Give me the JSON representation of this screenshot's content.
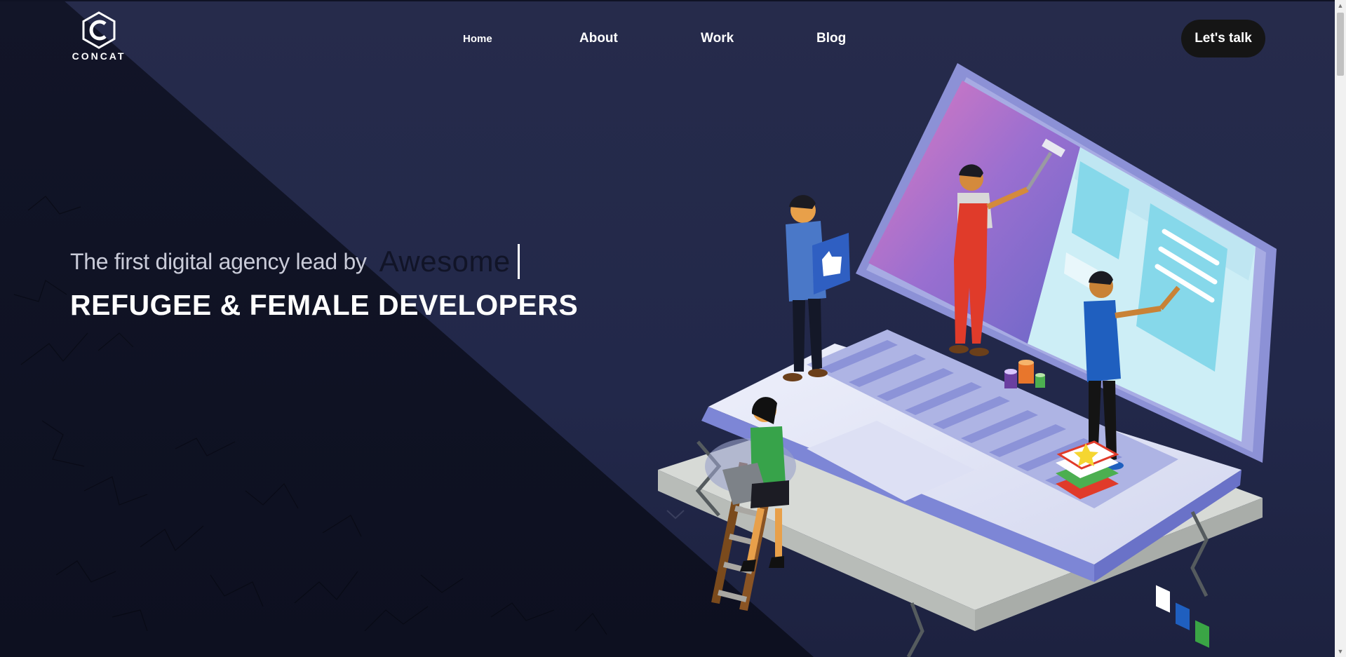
{
  "brand": {
    "name": "CONCAT",
    "logo_icon": "hexagon-c-logo-icon"
  },
  "nav": {
    "items": [
      {
        "label": "Home"
      },
      {
        "label": "About"
      },
      {
        "label": "Work"
      },
      {
        "label": "Blog"
      }
    ]
  },
  "cta": {
    "label": "Let's talk"
  },
  "hero": {
    "tagline": "The first digital agency lead by",
    "typed_word": "Awesome",
    "headline": "REFUGEE & FEMALE DEVELOPERS"
  },
  "colors": {
    "background": "#232847",
    "dark_wedge": "#0f1224",
    "cta_background": "#151515",
    "laptop_body": "#e3e6f5",
    "laptop_accent": "#7b82cf",
    "screen_gradient_start": "#e07ac0"
  },
  "illustration": {
    "icon": "isometric-laptop-team-illustration",
    "parts": [
      "laptop",
      "ladder",
      "painter",
      "person-with-like-sign",
      "person-drawing",
      "woman-with-laptop",
      "paint-cans",
      "stacked-books"
    ]
  },
  "scroll_icon": "chevron-down-icon"
}
